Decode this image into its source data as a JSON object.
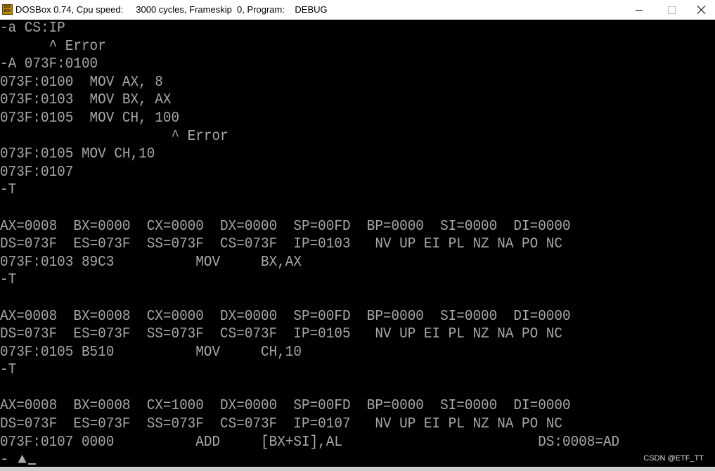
{
  "window": {
    "title": "DOSBox 0.74, Cpu speed:     3000 cycles, Frameskip  0, Program:    DEBUG",
    "icon": "dosbox-app-icon",
    "icon_text": "DOS BOX",
    "controls": {
      "minimize": "minimize-icon",
      "maximize": "maximize-icon",
      "close": "close-icon"
    }
  },
  "terminal": {
    "lines": [
      "-a CS:IP",
      "      ^ Error",
      "-A 073F:0100",
      "073F:0100  MOV AX, 8",
      "073F:0103  MOV BX, AX",
      "073F:0105  MOV CH, 100",
      "                     ^ Error",
      "073F:0105 MOV CH,10",
      "073F:0107",
      "-T",
      "",
      "AX=0008  BX=0000  CX=0000  DX=0000  SP=00FD  BP=0000  SI=0000  DI=0000",
      "DS=073F  ES=073F  SS=073F  CS=073F  IP=0103   NV UP EI PL NZ NA PO NC",
      "073F:0103 89C3          MOV     BX,AX",
      "-T",
      "",
      "AX=0008  BX=0008  CX=0000  DX=0000  SP=00FD  BP=0000  SI=0000  DI=0000",
      "DS=073F  ES=073F  SS=073F  CS=073F  IP=0105   NV UP EI PL NZ NA PO NC",
      "073F:0105 B510          MOV     CH,10",
      "-T",
      "",
      "AX=0008  BX=0008  CX=1000  DX=0000  SP=00FD  BP=0000  SI=0000  DI=0000",
      "DS=073F  ES=073F  SS=073F  CS=073F  IP=0107   NV UP EI PL NZ NA PO NC",
      "073F:0107 0000          ADD     [BX+SI],AL                        DS:0008=AD"
    ],
    "prompt": "- ▲"
  },
  "watermark": "CSDN @ETF_TT",
  "colors": {
    "background": "#000000",
    "text": "#a8a8a8",
    "titlebar": "#ffffff"
  }
}
